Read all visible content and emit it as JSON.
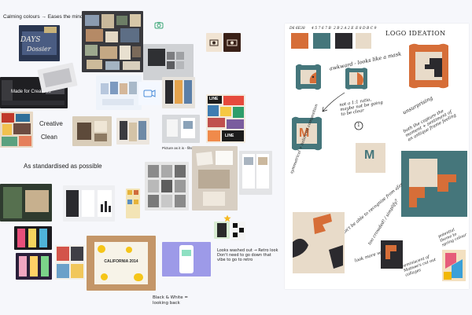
{
  "board": {
    "notes": {
      "calming": "Calming colours → Eases the mind",
      "made_for": "Made for Creatives",
      "creative": "Creative",
      "clean": "Clean",
      "standardised": "As standardised as possible",
      "picture_filtered": "Picture as it is - filtered on top",
      "washed_line1": "Looks washed out → Retro look",
      "washed_line2": "Don't need to go down that",
      "washed_line3": "vibe to go to retro",
      "bw_line1": "Black & White =",
      "bw_line2": "looking back",
      "collage_title": "DAYS",
      "collage_sub": "Dossier",
      "poster_title": "CALIFORNIA 2014",
      "line_badge_1": "LINE",
      "line_badge_2": "LINE"
    },
    "sheet": {
      "heading": "LOGO IDEATION",
      "swatches": [
        {
          "hex_label": "D6 6E38",
          "color": "#d66e38"
        },
        {
          "hex_label": "4 5 7 6 7 B",
          "color": "#45767b"
        },
        {
          "hex_label": "2 B 2 A 2 E",
          "color": "#2b2a2e"
        },
        {
          "hex_label": "E 8 D B C 9",
          "color": "#e8dbc9"
        }
      ],
      "annotations": {
        "awkward": "awkward - looks like a mask",
        "not_rotate": "not a 1:1 ratio, maybe not be going to be clear",
        "unsurprising": "unsurprising",
        "both_capture": "both the capture the moment + sentiment of an antique frame feeling",
        "symmetrical": "symmetrical + balanced composition",
        "recognise": "won't be able to recognise from afar",
        "too_crowded": "too crowded! / simplify?",
        "look_more": "look more version",
        "reminiscent": "reminiscent of Matisse's cut out collages",
        "potential": "potential theme to spring colour"
      },
      "m_letter": "M",
      "m_letter_small": "M",
      "circle_number": "1"
    }
  }
}
